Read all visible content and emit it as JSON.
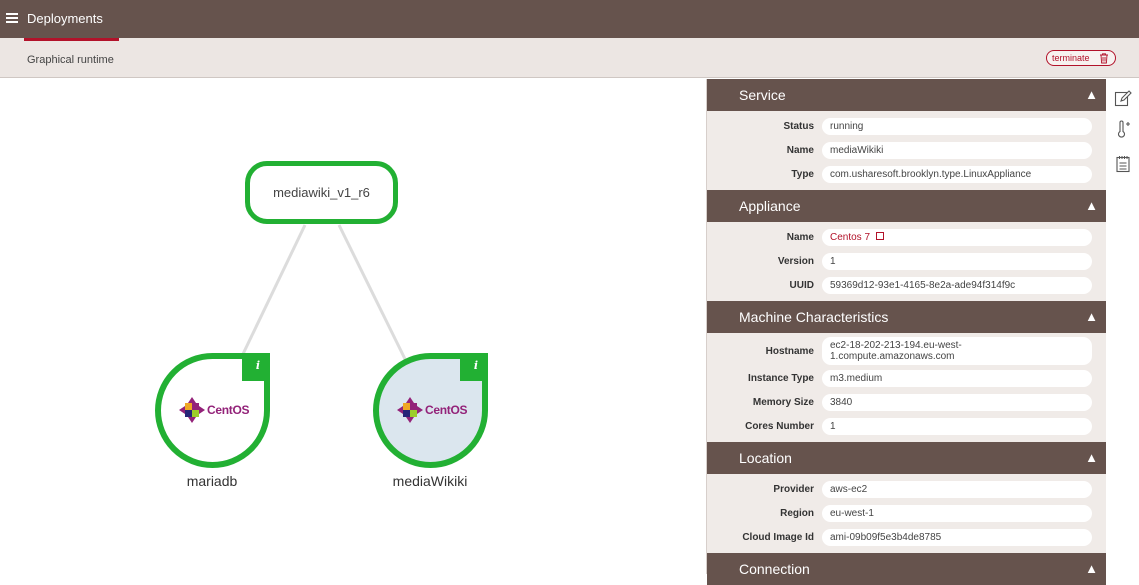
{
  "header": {
    "title": "Deployments",
    "menu_icon": "hamburger-icon"
  },
  "subbar": {
    "tab": "Graphical runtime",
    "terminate_label": "terminate",
    "terminate_icon": "trash-icon"
  },
  "graph": {
    "root": {
      "label": "mediawiki_v1_r6"
    },
    "nodes": [
      {
        "label": "mariadb",
        "os_logo_text": "CentOS"
      },
      {
        "label": "mediaWikiki",
        "os_logo_text": "CentOS"
      }
    ],
    "info_glyph": "i"
  },
  "panel": {
    "service": {
      "title": "Service",
      "rows": [
        {
          "label": "Status",
          "value": "running"
        },
        {
          "label": "Name",
          "value": "mediaWikiki"
        },
        {
          "label": "Type",
          "value": "com.usharesoft.brooklyn.type.LinuxAppliance"
        }
      ]
    },
    "appliance": {
      "title": "Appliance",
      "rows": [
        {
          "label": "Name",
          "value": "Centos 7"
        },
        {
          "label": "Version",
          "value": "1"
        },
        {
          "label": "UUID",
          "value": "59369d12-93e1-4165-8e2a-ade94f314f9c"
        }
      ]
    },
    "machine": {
      "title": "Machine Characteristics",
      "rows": [
        {
          "label": "Hostname",
          "value": "ec2-18-202-213-194.eu-west-1.compute.amazonaws.com"
        },
        {
          "label": "Instance Type",
          "value": "m3.medium"
        },
        {
          "label": "Memory Size",
          "value": "3840"
        },
        {
          "label": "Cores Number",
          "value": "1"
        }
      ]
    },
    "location": {
      "title": "Location",
      "rows": [
        {
          "label": "Provider",
          "value": "aws-ec2"
        },
        {
          "label": "Region",
          "value": "eu-west-1"
        },
        {
          "label": "Cloud Image Id",
          "value": "ami-09b09f5e3b4de8785"
        }
      ]
    },
    "connection": {
      "title": "Connection"
    },
    "collapse_arrow": "▲"
  },
  "colors": {
    "topbar": "#66534d",
    "accent": "#b2122a",
    "node_border": "#22b033"
  }
}
